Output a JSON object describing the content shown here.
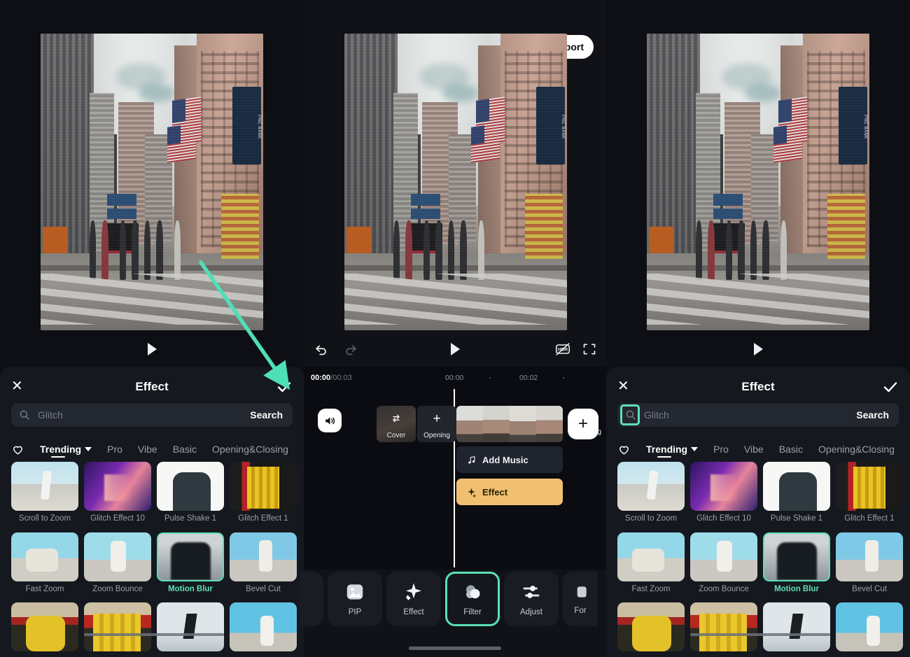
{
  "app": {
    "accent_green": "#5de0b5",
    "panel_bg": "#15181e",
    "page_bg": "#0d0f14"
  },
  "editor": {
    "close_label": "✕",
    "export_label": "Export",
    "export_icon": "upload-icon",
    "controls": {
      "undo": "undo-icon",
      "redo": "redo-icon",
      "play": "play-icon",
      "hdr_off": "hdr-off-icon",
      "fullscreen": "fullscreen-icon"
    },
    "timeline": {
      "current_time": "00:00",
      "total_time": "/00:03",
      "ruler_ticks": [
        "00:00",
        "·",
        "00:02",
        "·"
      ],
      "volume_icon": "volume-icon",
      "cover_label": "Cover",
      "cover_icon": "swap-icon",
      "opening_label": "Opening",
      "opening_icon": "plus-icon",
      "add_clip_icon": "plus-icon",
      "ending_label": "ng",
      "tracks": [
        {
          "label": "Add Music",
          "icon": "music-note-icon",
          "style": "music"
        },
        {
          "label": "Effect",
          "icon": "sparkle-icon",
          "style": "effect"
        }
      ]
    },
    "toolbar": [
      {
        "label": "",
        "icon": "partial-icon",
        "selected": false
      },
      {
        "label": "PIP",
        "icon": "picture-icon",
        "selected": false
      },
      {
        "label": "Effect",
        "icon": "sparkle-icon",
        "selected": false
      },
      {
        "label": "Filter",
        "icon": "filter-circles-icon",
        "selected": true
      },
      {
        "label": "Adjust",
        "icon": "sliders-icon",
        "selected": false
      },
      {
        "label": "For",
        "icon": "format-icon",
        "selected": false
      }
    ]
  },
  "effect_panel": {
    "close_icon": "close-icon",
    "title": "Effect",
    "confirm_icon": "check-icon",
    "search": {
      "icon": "search-icon",
      "placeholder": "Glitch",
      "button_label": "Search"
    },
    "tabs": {
      "favorite_icon": "heart-icon",
      "items": [
        {
          "label": "Trending",
          "active": true,
          "has_caret": true
        },
        {
          "label": "Pro",
          "active": false,
          "has_caret": false
        },
        {
          "label": "Vibe",
          "active": false,
          "has_caret": false
        },
        {
          "label": "Basic",
          "active": false,
          "has_caret": false
        },
        {
          "label": "Opening&Closing",
          "active": false,
          "has_caret": false
        }
      ]
    },
    "effects": [
      {
        "label": "Scroll to Zoom",
        "art": "a-skate",
        "selected": false
      },
      {
        "label": "Glitch Effect 10",
        "art": "a-neon",
        "selected": false
      },
      {
        "label": "Pulse Shake 1",
        "art": "a-hoodwhite",
        "selected": false
      },
      {
        "label": "Glitch Effect 1",
        "art": "a-yellow",
        "selected": false
      },
      {
        "label": "Fast Zoom",
        "art": "a-sit",
        "selected": false
      },
      {
        "label": "Zoom Bounce",
        "art": "a-bounce",
        "selected": false
      },
      {
        "label": "Motion Blur",
        "art": "a-blur",
        "selected": true
      },
      {
        "label": "Bevel Cut",
        "art": "a-bevel",
        "selected": false
      },
      {
        "label": "",
        "art": "a-ylady",
        "selected": false
      },
      {
        "label": "",
        "art": "a-ylady2",
        "selected": false
      },
      {
        "label": "",
        "art": "a-snow",
        "selected": false
      },
      {
        "label": "",
        "art": "a-sky2",
        "selected": false
      }
    ]
  },
  "preview": {
    "sign_text": "PNC BANK",
    "play_icon": "play-icon"
  },
  "annotations": {
    "arrow_color": "#4fdfb5",
    "arrow_target": "confirm-check-button",
    "highlight_color": "#5de0b5",
    "highlight_targets": [
      "filter-tool-button",
      "search-icon-right",
      "motion-blur-effect"
    ]
  }
}
